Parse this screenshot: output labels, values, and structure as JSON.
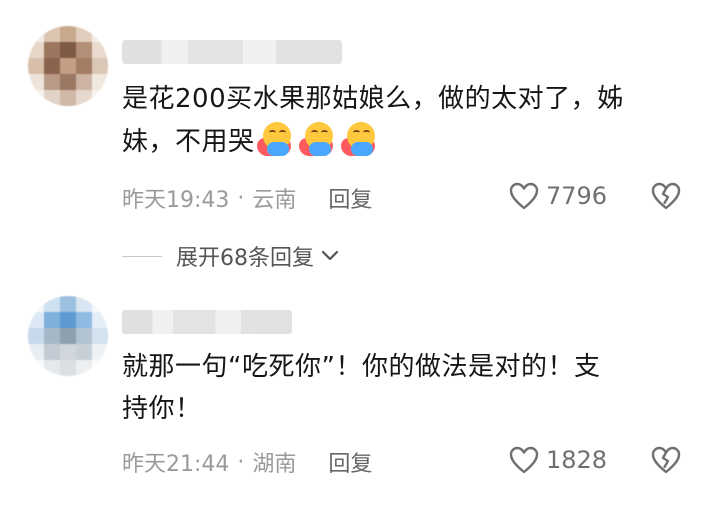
{
  "comments": [
    {
      "text_line1": "是花200买水果那姑娘么，做的太对了，姊",
      "text_line2": "妹，不用哭",
      "emoji_names": [
        "hug-emoji",
        "hug-emoji",
        "hug-emoji"
      ],
      "time": "昨天19:43",
      "separator": "·",
      "location": "云南",
      "reply_label": "回复",
      "likes": "7796"
    },
    {
      "text_line1": "就那一句“吃死你”！你的做法是对的！支",
      "text_line2": "持你！",
      "time": "昨天21:44",
      "separator": "·",
      "location": "湖南",
      "reply_label": "回复",
      "likes": "1828"
    }
  ],
  "expand_replies": "展开68条回复",
  "colors": {
    "meta_text": "#9a9a9a",
    "content_text": "#161616",
    "icon": "#707070"
  }
}
